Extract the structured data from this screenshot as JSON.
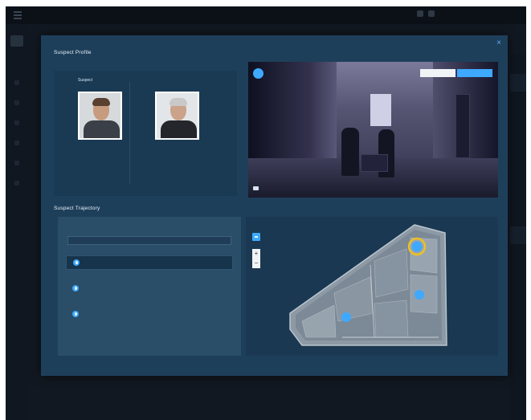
{
  "topbar": {
    "app_title": "",
    "center_title": ""
  },
  "modal": {
    "title": "Suspect Profile"
  },
  "profile": {
    "persons": [
      {
        "tag": "Suspect",
        "name_line1": "",
        "name_line2": ""
      },
      {
        "tag": "",
        "name_line1": "",
        "name_line2": ""
      }
    ]
  },
  "video": {
    "camera_label": "",
    "camera_sub": "",
    "button_secondary": "",
    "button_primary": "",
    "footer": ""
  },
  "trajectory": {
    "title": "Suspect Trajectory",
    "field_label": "",
    "field_value": "",
    "rows": [
      {
        "camera": "",
        "time": "",
        "link": "",
        "active": true
      },
      {
        "camera": "",
        "time": "",
        "link": "",
        "active": false
      },
      {
        "camera": "",
        "time": "",
        "link": "",
        "active": false
      }
    ]
  },
  "map": {
    "floor_label": "",
    "zoom_in": "+",
    "zoom_out": "−"
  },
  "colors": {
    "modal_bg": "#1e3f5a",
    "accent": "#3ea9ff",
    "highlight_marker": "#f0c020"
  },
  "icons": [
    "menu-icon",
    "close-icon",
    "camera-icon",
    "map-pin-icon",
    "floor-icon"
  ]
}
